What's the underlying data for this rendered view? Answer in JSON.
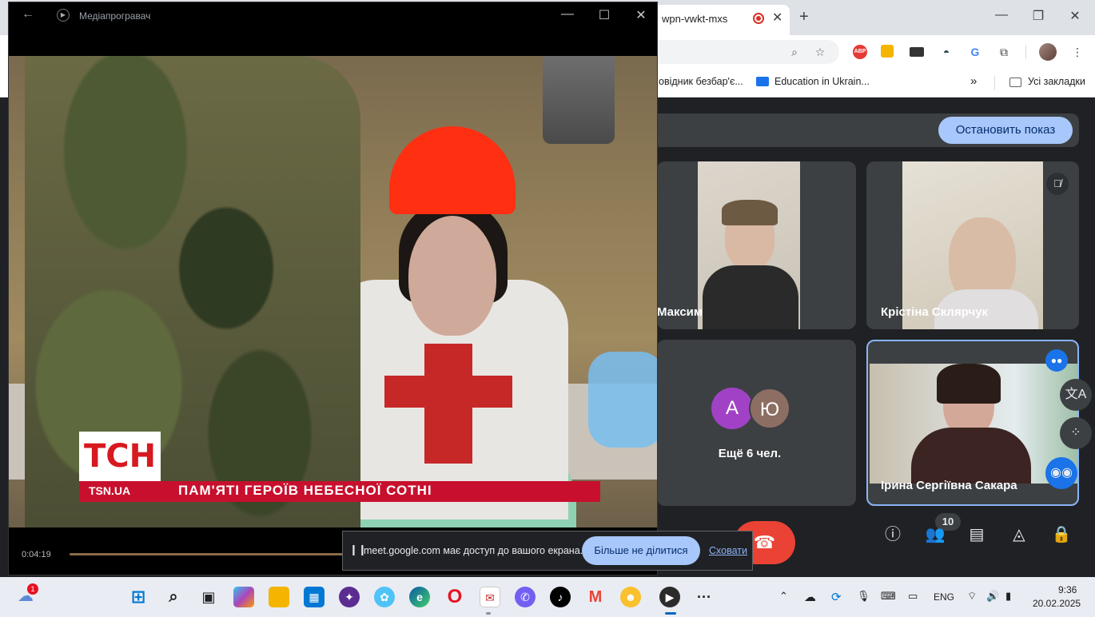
{
  "chrome": {
    "tab_title": "wpn-vwkt-mxs",
    "tab_close_icon": "close-icon",
    "new_tab": "+",
    "minimize": "—",
    "restore": "❐",
    "close": "✕",
    "bookmarks": [
      {
        "label": "овідник безбар'є..."
      },
      {
        "label": "Education in Ukrain..."
      },
      {
        "label": "»"
      },
      {
        "label": "Усі закладки"
      }
    ],
    "toolbar_icons": [
      "zoom-icon",
      "star-icon",
      "adblock-icon",
      "extension-icon",
      "extension-icon",
      "extension-icon",
      "translate-icon",
      "puzzle-icon",
      "profile-avatar"
    ],
    "abp_label": "ABP"
  },
  "meet": {
    "stop_presenting": "Остановить показ",
    "tiles": [
      {
        "name": "Максим"
      },
      {
        "name": "Крістіна Склярчук"
      },
      {
        "name": "Ірина Сергіївна Сакара"
      }
    ],
    "others": {
      "avatars": [
        "А",
        "Ю"
      ],
      "avatar_colors": [
        "#a142c6",
        "#8d6e63"
      ],
      "label": "Ещё 6 чел."
    },
    "people_count": "10",
    "hangup_color": "#ea4335"
  },
  "player": {
    "title": "Медіапрогравач",
    "time_elapsed": "0:04:19",
    "progress": 0.42,
    "tsn": {
      "logo": "ТСН",
      "url": "TSN.UA",
      "headline": "ПАМ'ЯТІ ГЕРОЇВ НЕБЕСНОЇ СОТНІ"
    }
  },
  "share_notice": {
    "text": "meet.google.com має доступ до вашого екрана.",
    "stop_button": "Більше не ділитися",
    "hide_link": "Сховати"
  },
  "taskbar": {
    "weather_badge": "1",
    "language": "ENG",
    "time": "9:36",
    "date": "20.02.2025",
    "apps": [
      "start-icon",
      "search-icon",
      "task-view-icon",
      "copilot-icon",
      "file-explorer-icon",
      "store-icon",
      "app-icon",
      "app-icon",
      "edge-icon",
      "opera-icon",
      "app-icon",
      "viber-icon",
      "tiktok-icon",
      "gmail-icon",
      "app-icon",
      "media-player-icon",
      "more-icon"
    ]
  }
}
